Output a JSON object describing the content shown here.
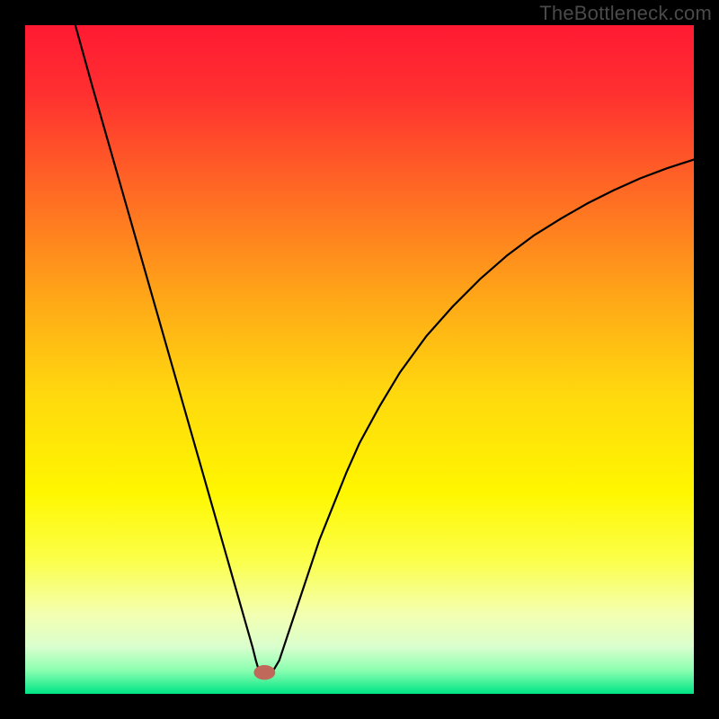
{
  "watermark": "TheBottleneck.com",
  "chart_data": {
    "type": "line",
    "title": "",
    "xlabel": "",
    "ylabel": "",
    "xlim": [
      0,
      100
    ],
    "ylim": [
      0,
      100
    ],
    "background_gradient": {
      "stops": [
        {
          "offset": 0.0,
          "color": "#ff1a33"
        },
        {
          "offset": 0.1,
          "color": "#ff2f30"
        },
        {
          "offset": 0.25,
          "color": "#ff6a24"
        },
        {
          "offset": 0.4,
          "color": "#ffa418"
        },
        {
          "offset": 0.55,
          "color": "#ffd80e"
        },
        {
          "offset": 0.7,
          "color": "#fff700"
        },
        {
          "offset": 0.8,
          "color": "#fbff4a"
        },
        {
          "offset": 0.88,
          "color": "#f4ffb0"
        },
        {
          "offset": 0.93,
          "color": "#d9ffce"
        },
        {
          "offset": 0.965,
          "color": "#8affb0"
        },
        {
          "offset": 1.0,
          "color": "#00e585"
        }
      ]
    },
    "series": [
      {
        "name": "bottleneck-curve",
        "color": "#000000",
        "stroke_width": 2.2,
        "x": [
          7.5,
          10,
          12,
          14,
          16,
          18,
          20,
          22,
          24,
          26,
          28,
          30,
          31,
          32,
          33,
          34,
          34.5,
          35,
          36,
          37,
          38,
          39,
          40,
          42,
          44,
          46,
          48,
          50,
          53,
          56,
          60,
          64,
          68,
          72,
          76,
          80,
          84,
          88,
          92,
          96,
          100
        ],
        "y": [
          100,
          91,
          84,
          77,
          70,
          63,
          56,
          49,
          42,
          35,
          28,
          21,
          17.5,
          14,
          10.5,
          7,
          5,
          3.3,
          3.3,
          3.3,
          5,
          8,
          11,
          17,
          23,
          28,
          33,
          37.5,
          43,
          48,
          53.5,
          58,
          62,
          65.5,
          68.5,
          71,
          73.3,
          75.3,
          77.1,
          78.6,
          79.9
        ]
      }
    ],
    "marker": {
      "name": "bottleneck-marker",
      "x": 35.8,
      "y": 3.2,
      "rx": 1.6,
      "ry": 1.1,
      "color": "#c0685a"
    }
  }
}
